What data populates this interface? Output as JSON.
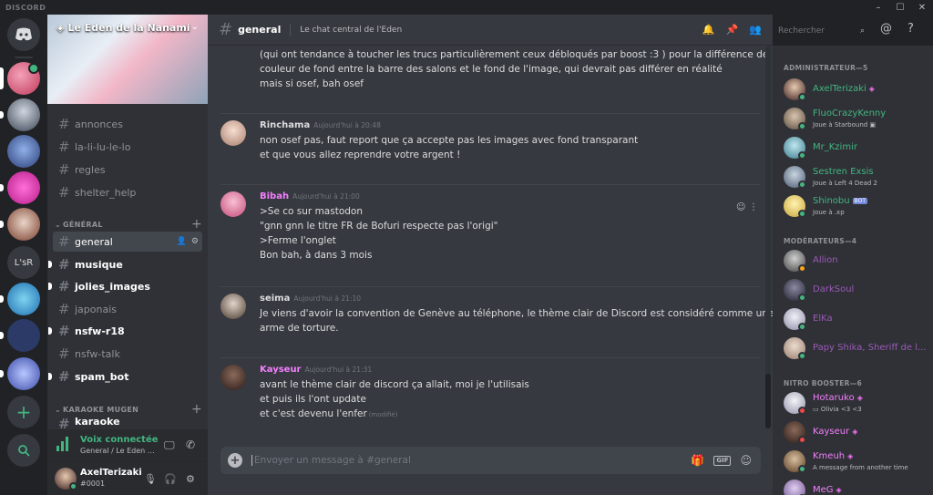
{
  "app": {
    "title": "DISCORD"
  },
  "window": {
    "minimize": "–",
    "maximize": "☐",
    "close": "✕"
  },
  "server": {
    "name": "Le Eden de la Nanami"
  },
  "sidebar": {
    "channels_top": [
      {
        "label": "annonces"
      },
      {
        "label": "la-li-lu-le-lo"
      },
      {
        "label": "regles"
      },
      {
        "label": "shelter_help"
      }
    ],
    "category_general": "GÉNÉRAL",
    "channels_general": [
      {
        "label": "general"
      },
      {
        "label": "musique"
      },
      {
        "label": "jolies_images"
      },
      {
        "label": "japonais"
      },
      {
        "label": "nsfw-r18"
      },
      {
        "label": "nsfw-talk"
      },
      {
        "label": "spam_bot"
      }
    ],
    "category_karaoke": "KARAOKE MUGEN",
    "channel_karaoke": "karaoke"
  },
  "voice": {
    "status": "Voix connectée",
    "location": "General / Le Eden de l..."
  },
  "user": {
    "name": "AxelTerizaki",
    "tag": "#0001"
  },
  "channel_header": {
    "name": "general",
    "topic": "Le chat central de l'Eden"
  },
  "search": {
    "placeholder": "Rechercher"
  },
  "messages": {
    "continuation": [
      "(qui ont tendance à toucher les trucs particulièrement ceux débloqués par boost :3 ) pour la différence de",
      "couleur de fond entre la barre des salons et le fond de l'image, qui devrait pas différer en réalité",
      "mais si osef, bah osef"
    ],
    "m1": {
      "author": "Rinchama",
      "time": "Aujourd'hui à 20:48",
      "lines": [
        "non osef pas, faut report que ça accepte pas les images avec fond transparant",
        "et que vous allez reprendre votre argent !"
      ]
    },
    "m2": {
      "author": "Bibah",
      "time": "Aujourd'hui à 21:00",
      "lines": [
        ">Se co sur mastodon",
        "\"gnn gnn le titre FR de Bofuri respecte pas l'origi\"",
        ">Ferme l'onglet",
        "Bon bah, à dans 3 mois"
      ]
    },
    "m3": {
      "author": "seima",
      "time": "Aujourd'hui à 21:10",
      "lines": [
        "Je viens d'avoir la convention de Genève au téléphone, le thème clair de Discord est considéré comme une",
        "arme de torture."
      ]
    },
    "m4": {
      "author": "Kayseur",
      "time": "Aujourd'hui à 21:31",
      "lines": [
        "avant le thème clair de discord ça allait, moi je l'utilisais",
        "et puis ils l'ont update",
        "et c'est devenu l'enfer"
      ],
      "edited": "(modifié)"
    }
  },
  "composer": {
    "placeholder": "Envoyer un message à #general",
    "gif": "GIF"
  },
  "members": {
    "admin_header": "ADMINISTRATEUR—5",
    "admins": [
      {
        "name": "AxelTerizaki",
        "status": ""
      },
      {
        "name": "FluoCrazyKenny",
        "status": "Joue à Starbound"
      },
      {
        "name": "Mr_Kzimir",
        "status": ""
      },
      {
        "name": "Sestren Exsis",
        "status": "Joue à Left 4 Dead 2"
      },
      {
        "name": "Shinobu",
        "status": "Joue à .xp",
        "badge": "BOT"
      }
    ],
    "mod_header": "MODÉRATEURS—4",
    "mods": [
      {
        "name": "Allion"
      },
      {
        "name": "DarkSoul"
      },
      {
        "name": "ElKa"
      },
      {
        "name": "Papy Shika, Sheriff de l..."
      }
    ],
    "booster_header": "NITRO BOOSTER—6",
    "boosters": [
      {
        "name": "Hotaruko",
        "status": "Olivia <3 <3"
      },
      {
        "name": "Kayseur",
        "status": ""
      },
      {
        "name": "Kmeuh",
        "status": "A message from another time"
      },
      {
        "name": "MeG",
        "status": ""
      }
    ]
  },
  "colors": {
    "admin": "#43b581",
    "mod": "#9b59b6",
    "booster": "#f47fff",
    "online": "#43b581",
    "dnd": "#f04747",
    "idle": "#faa61a"
  }
}
